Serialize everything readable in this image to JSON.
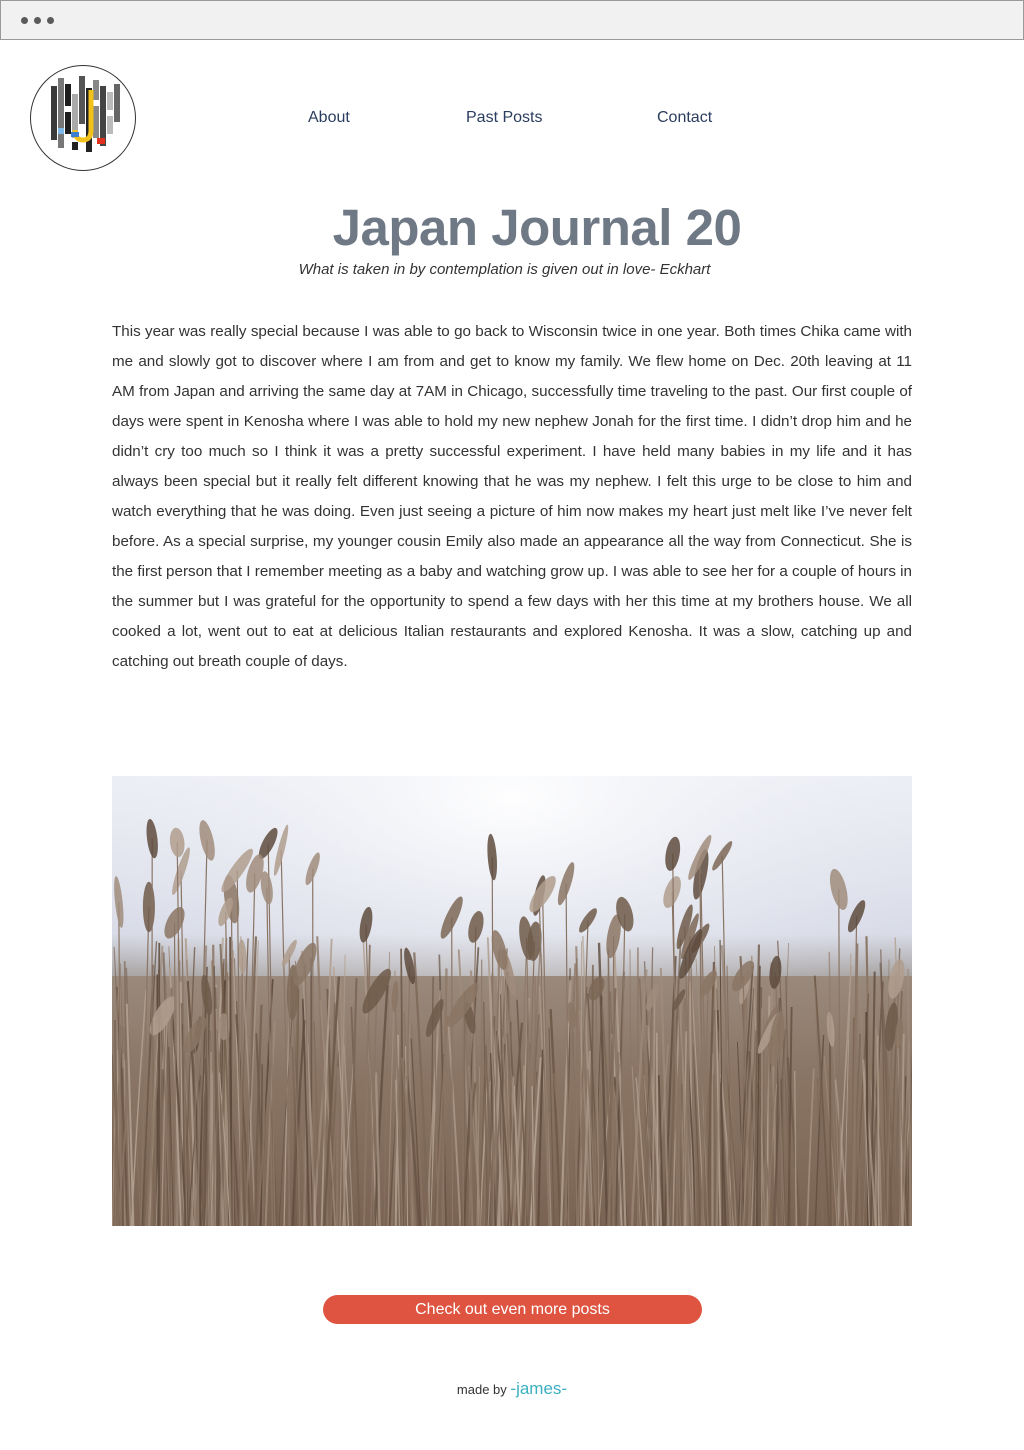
{
  "nav": {
    "about": "About",
    "past_posts": "Past Posts",
    "contact": "Contact"
  },
  "post": {
    "title": "Japan Journal 20",
    "quote": "What is taken in by contemplation is given out in love- Eckhart",
    "body": "This year was really special because I was able to go back to Wisconsin twice in one year. Both times Chika came with me and slowly got to discover where I am from and get to know my family. We flew home on Dec. 20th leaving at 11 AM from Japan and arriving the same day at 7AM in Chicago, successfully time traveling to the past. Our first couple of days were spent in Kenosha where I was able to hold my new nephew Jonah for the first time. I didn’t drop him and he didn’t cry too much so I think it was a pretty successful experiment. I have held many babies in my life and it has always been special but it really felt different knowing that he was my nephew. I felt this urge to be close to him and watch everything that he was doing. Even just seeing a picture of him now makes my heart just melt like I’ve never felt before. As a special surprise, my younger cousin Emily also made an appearance all the way from Connecticut. She is the first person that I remember meeting as a baby and watching grow up. I was able to see her for a couple of hours in the summer but I was grateful for the opportunity to spend a few days with her this time at my brothers house. We all cooked a lot, went out to eat at delicious Italian restaurants and explored Kenosha. It was a slow, catching up and catching out breath couple of days."
  },
  "cta": {
    "label": "Check out even more posts",
    "color": "#de5440"
  },
  "footer": {
    "made_by": "made by",
    "author": "-james-"
  },
  "colors": {
    "title": "#6e7985",
    "nav": "#2b3d5e",
    "author": "#3ab0c0"
  },
  "icons": {
    "logo": "pixel-j-logo",
    "browser_dots": "window-dots-icon"
  }
}
